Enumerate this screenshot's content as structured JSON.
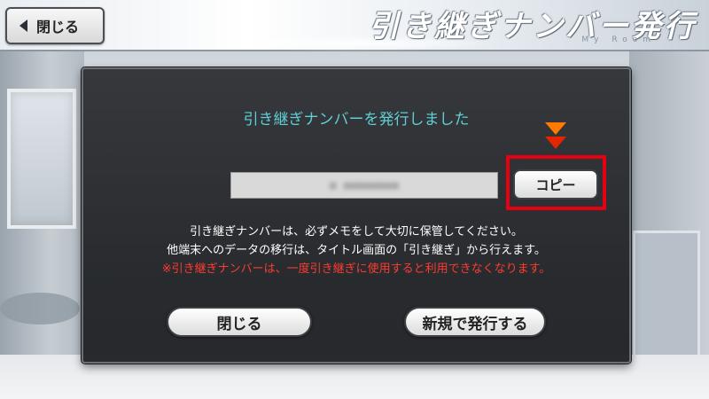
{
  "top_bar": {
    "back_label": "閉じる",
    "title": "引き継ぎナンバー発行",
    "subtitle": "My Room"
  },
  "dialog": {
    "heading": "引き継ぎナンバーを発行しました",
    "number_value": "■ ■■■■■■■■",
    "copy_label": "コピー",
    "notice_line1": "引き継ぎナンバーは、必ずメモをして大切に保管してください。",
    "notice_line2": "他端末へのデータの移行は、タイトル画面の「引き継ぎ」から行えます。",
    "warning_line": "※引き継ぎナンバーは、一度引き継ぎに使用すると利用できなくなります。",
    "close_label": "閉じる",
    "reissue_label": "新規で発行する"
  },
  "colors": {
    "heading": "#5fd0d6",
    "warning": "#ff3b30",
    "highlight": "#e50012",
    "arrow": "#ff6a00"
  }
}
